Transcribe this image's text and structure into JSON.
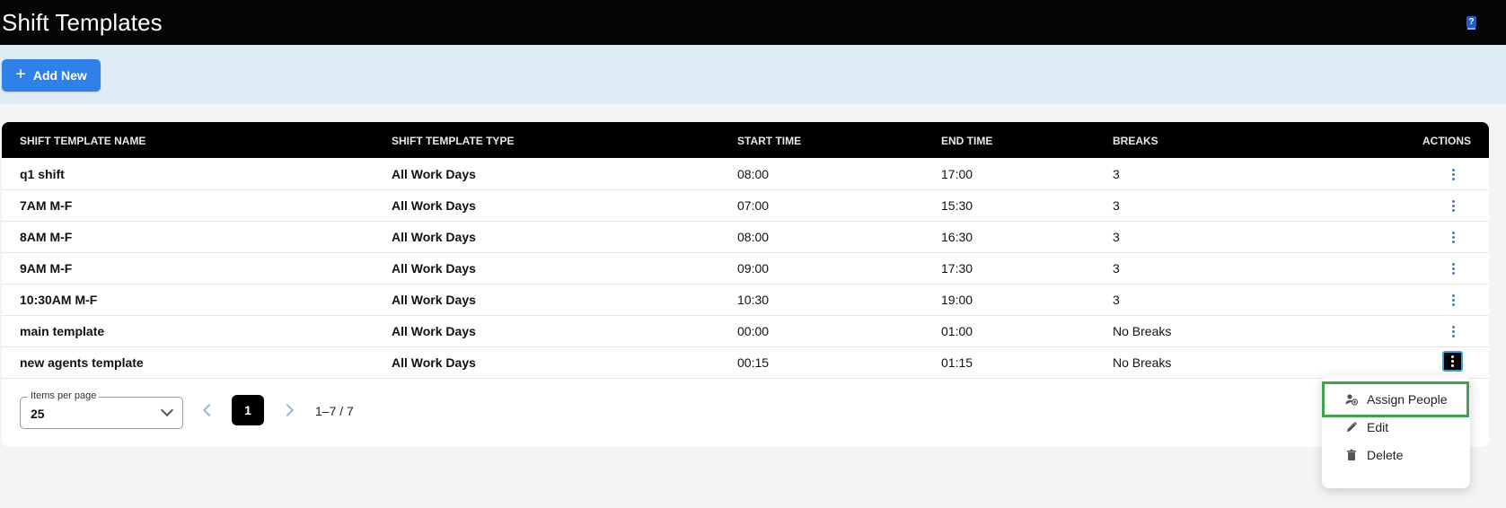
{
  "header": {
    "title": "Shift Templates",
    "help_icon": "help-book-icon"
  },
  "toolbar": {
    "add_new_label": "Add New"
  },
  "table": {
    "columns": [
      "SHIFT TEMPLATE NAME",
      "SHIFT TEMPLATE TYPE",
      "START TIME",
      "END TIME",
      "BREAKS",
      "ACTIONS"
    ],
    "rows": [
      {
        "name": "q1 shift",
        "type": "All Work Days",
        "start": "08:00",
        "end": "17:00",
        "breaks": "3"
      },
      {
        "name": "7AM M-F",
        "type": "All Work Days",
        "start": "07:00",
        "end": "15:30",
        "breaks": "3"
      },
      {
        "name": "8AM M-F",
        "type": "All Work Days",
        "start": "08:00",
        "end": "16:30",
        "breaks": "3"
      },
      {
        "name": "9AM M-F",
        "type": "All Work Days",
        "start": "09:00",
        "end": "17:30",
        "breaks": "3"
      },
      {
        "name": "10:30AM M-F",
        "type": "All Work Days",
        "start": "10:30",
        "end": "19:00",
        "breaks": "3"
      },
      {
        "name": "main template",
        "type": "All Work Days",
        "start": "00:00",
        "end": "01:00",
        "breaks": "No Breaks"
      },
      {
        "name": "new agents template",
        "type": "All Work Days",
        "start": "00:15",
        "end": "01:15",
        "breaks": "No Breaks"
      }
    ]
  },
  "pagination": {
    "items_per_page_label": "Items per page",
    "items_per_page_value": "25",
    "current_page": "1",
    "range_text": "1–7 / 7"
  },
  "action_menu": {
    "items": [
      {
        "label": "Assign People",
        "icon": "assign-person-icon"
      },
      {
        "label": "Edit",
        "icon": "pencil-icon"
      },
      {
        "label": "Delete",
        "icon": "trash-icon"
      }
    ]
  },
  "colors": {
    "accent": "#2f80e8",
    "header_bg": "#050505",
    "toolbar_bg": "#deedf5",
    "highlight": "#3fa24c"
  }
}
